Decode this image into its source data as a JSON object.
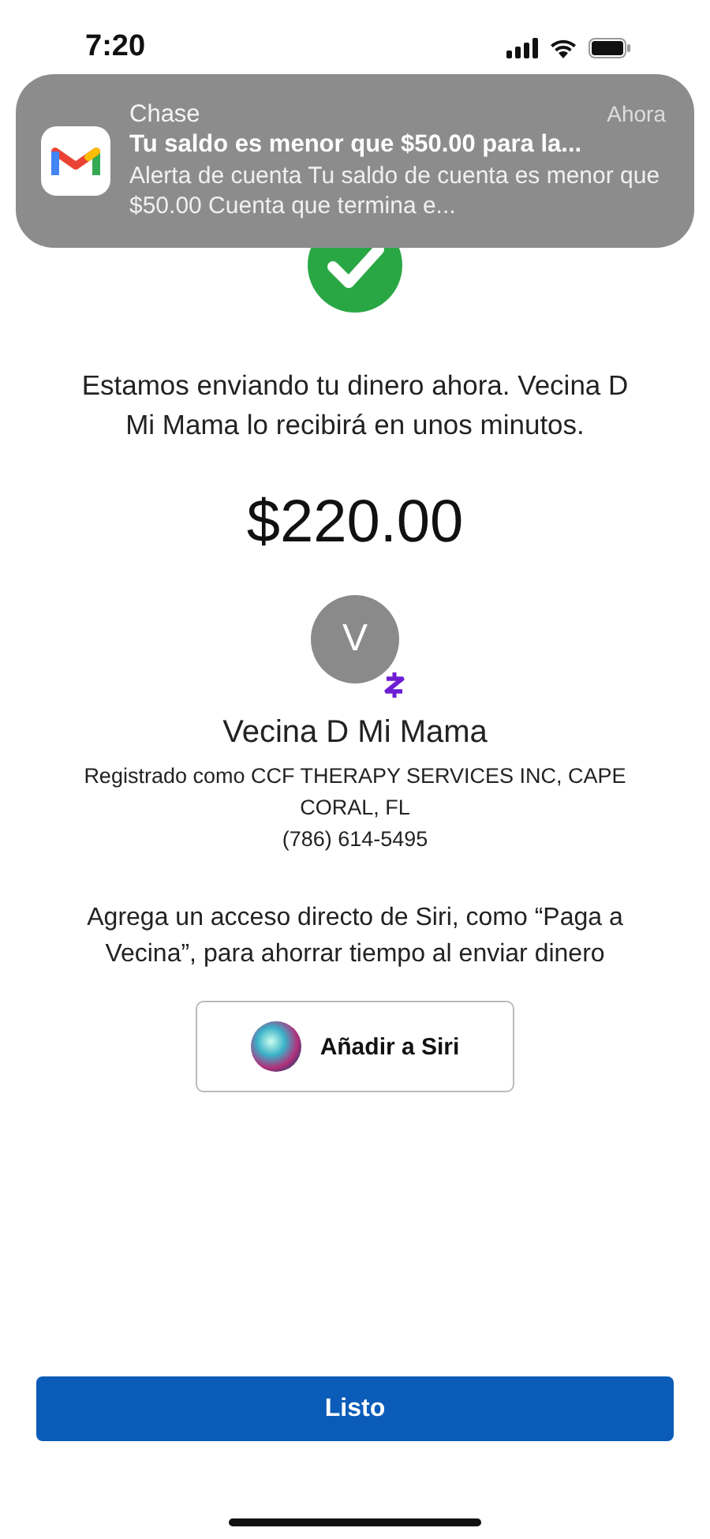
{
  "status_bar": {
    "time": "7:20"
  },
  "notification": {
    "app": "Chase",
    "time": "Ahora",
    "title": "Tu saldo es menor que $50.00 para la...",
    "body": "Alerta de cuenta Tu saldo de cuenta es menor que $50.00 Cuenta que termina e..."
  },
  "message": "Estamos enviando tu dinero ahora. Vecina D Mi Mama lo recibirá en unos minutos.",
  "amount": "$220.00",
  "recipient": {
    "initial": "V",
    "name": "Vecina D Mi Mama",
    "registered": "Registrado como CCF THERAPY SERVICES INC, CAPE CORAL, FL",
    "phone": "(786) 614-5495"
  },
  "siri": {
    "text": "Agrega un acceso directo de Siri, como “Paga a Vecina”, para ahorrar tiempo al enviar dinero",
    "button": "Añadir a Siri"
  },
  "done_button": "Listo"
}
